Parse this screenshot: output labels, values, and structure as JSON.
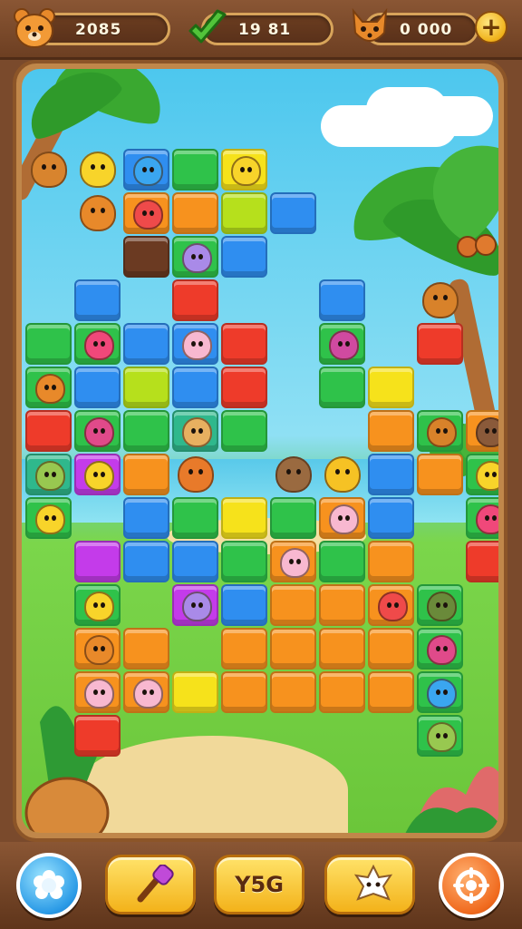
{
  "hud": {
    "left_counter": {
      "icon": "bear-face-icon",
      "value": "2085"
    },
    "middle_counter": {
      "icon": "green-checkmark-icon",
      "value": "19 81"
    },
    "right_counter": {
      "icon": "fox-face-icon",
      "value": "0 000",
      "add_icon": "plus-icon",
      "add_label": "+"
    }
  },
  "colors": {
    "blue": "#2f8ef0",
    "green": "#2fc24a",
    "lime": "#b6e01c",
    "yellow": "#f6e21b",
    "orange": "#f7921e",
    "red": "#ee3b2a",
    "purple": "#c43bea",
    "brown": "#6b3a22",
    "teal": "#2fb88c"
  },
  "board": {
    "tiles": [
      {
        "row": 0,
        "col": 2,
        "color": "blue",
        "animal": "blue-bird"
      },
      {
        "row": 0,
        "col": 3,
        "color": "green",
        "animal": ""
      },
      {
        "row": 0,
        "col": 4,
        "color": "yellow",
        "animal": "yellow-chick"
      },
      {
        "row": 1,
        "col": 2,
        "color": "orange",
        "animal": "red-bird"
      },
      {
        "row": 1,
        "col": 3,
        "color": "orange",
        "animal": ""
      },
      {
        "row": 1,
        "col": 4,
        "color": "lime",
        "animal": ""
      },
      {
        "row": 1,
        "col": 5,
        "color": "blue",
        "animal": ""
      },
      {
        "row": 2,
        "col": 2,
        "color": "brown",
        "animal": ""
      },
      {
        "row": 2,
        "col": 3,
        "color": "green",
        "animal": "purple-hippo"
      },
      {
        "row": 2,
        "col": 4,
        "color": "blue",
        "animal": ""
      },
      {
        "row": 3,
        "col": 1,
        "color": "blue",
        "animal": ""
      },
      {
        "row": 3,
        "col": 3,
        "color": "red",
        "animal": ""
      },
      {
        "row": 3,
        "col": 6,
        "color": "blue",
        "animal": ""
      },
      {
        "row": 4,
        "col": 0,
        "color": "green",
        "animal": ""
      },
      {
        "row": 4,
        "col": 1,
        "color": "green",
        "animal": "pink-bird"
      },
      {
        "row": 4,
        "col": 2,
        "color": "blue",
        "animal": ""
      },
      {
        "row": 4,
        "col": 3,
        "color": "blue",
        "animal": "pink-pig"
      },
      {
        "row": 4,
        "col": 4,
        "color": "red",
        "animal": ""
      },
      {
        "row": 4,
        "col": 6,
        "color": "green",
        "animal": "purple-bird"
      },
      {
        "row": 4,
        "col": 8,
        "color": "red",
        "animal": ""
      },
      {
        "row": 5,
        "col": 0,
        "color": "green",
        "animal": "orange-bear"
      },
      {
        "row": 5,
        "col": 1,
        "color": "blue",
        "animal": ""
      },
      {
        "row": 5,
        "col": 2,
        "color": "lime",
        "animal": ""
      },
      {
        "row": 5,
        "col": 3,
        "color": "blue",
        "animal": ""
      },
      {
        "row": 5,
        "col": 4,
        "color": "red",
        "animal": ""
      },
      {
        "row": 5,
        "col": 6,
        "color": "green",
        "animal": ""
      },
      {
        "row": 5,
        "col": 7,
        "color": "yellow",
        "animal": ""
      },
      {
        "row": 6,
        "col": 0,
        "color": "red",
        "animal": ""
      },
      {
        "row": 6,
        "col": 1,
        "color": "green",
        "animal": "magenta-bird"
      },
      {
        "row": 6,
        "col": 2,
        "color": "green",
        "animal": ""
      },
      {
        "row": 6,
        "col": 3,
        "color": "teal",
        "animal": "hamster"
      },
      {
        "row": 6,
        "col": 4,
        "color": "green",
        "animal": ""
      },
      {
        "row": 6,
        "col": 7,
        "color": "orange",
        "animal": ""
      },
      {
        "row": 6,
        "col": 8,
        "color": "green",
        "animal": "squirrel"
      },
      {
        "row": 6,
        "col": 9,
        "color": "orange",
        "animal": "brown-dog"
      },
      {
        "row": 7,
        "col": 0,
        "color": "teal",
        "animal": "green-frog"
      },
      {
        "row": 7,
        "col": 1,
        "color": "purple",
        "animal": "yellow-chick"
      },
      {
        "row": 7,
        "col": 2,
        "color": "orange",
        "animal": ""
      },
      {
        "row": 7,
        "col": 7,
        "color": "blue",
        "animal": ""
      },
      {
        "row": 7,
        "col": 8,
        "color": "orange",
        "animal": ""
      },
      {
        "row": 7,
        "col": 9,
        "color": "green",
        "animal": "yellow-chick"
      },
      {
        "row": 8,
        "col": 0,
        "color": "green",
        "animal": "yellow-chick"
      },
      {
        "row": 8,
        "col": 2,
        "color": "blue",
        "animal": ""
      },
      {
        "row": 8,
        "col": 3,
        "color": "green",
        "animal": ""
      },
      {
        "row": 8,
        "col": 4,
        "color": "yellow",
        "animal": ""
      },
      {
        "row": 8,
        "col": 5,
        "color": "green",
        "animal": ""
      },
      {
        "row": 8,
        "col": 6,
        "color": "orange",
        "animal": "pink-pig"
      },
      {
        "row": 8,
        "col": 7,
        "color": "blue",
        "animal": ""
      },
      {
        "row": 8,
        "col": 9,
        "color": "green",
        "animal": "pink-bird"
      },
      {
        "row": 9,
        "col": 1,
        "color": "purple",
        "animal": ""
      },
      {
        "row": 9,
        "col": 2,
        "color": "blue",
        "animal": ""
      },
      {
        "row": 9,
        "col": 3,
        "color": "blue",
        "animal": ""
      },
      {
        "row": 9,
        "col": 4,
        "color": "green",
        "animal": ""
      },
      {
        "row": 9,
        "col": 5,
        "color": "orange",
        "animal": "pink-pig"
      },
      {
        "row": 9,
        "col": 6,
        "color": "green",
        "animal": ""
      },
      {
        "row": 9,
        "col": 7,
        "color": "orange",
        "animal": ""
      },
      {
        "row": 9,
        "col": 9,
        "color": "red",
        "animal": ""
      },
      {
        "row": 10,
        "col": 1,
        "color": "green",
        "animal": "yellow-chick"
      },
      {
        "row": 10,
        "col": 3,
        "color": "purple",
        "animal": "purple-hippo"
      },
      {
        "row": 10,
        "col": 4,
        "color": "blue",
        "animal": ""
      },
      {
        "row": 10,
        "col": 5,
        "color": "orange",
        "animal": ""
      },
      {
        "row": 10,
        "col": 6,
        "color": "orange",
        "animal": ""
      },
      {
        "row": 10,
        "col": 7,
        "color": "orange",
        "animal": "red-bird"
      },
      {
        "row": 10,
        "col": 8,
        "color": "green",
        "animal": "green-turtle"
      },
      {
        "row": 11,
        "col": 1,
        "color": "orange",
        "animal": "orange-bear"
      },
      {
        "row": 11,
        "col": 2,
        "color": "orange",
        "animal": ""
      },
      {
        "row": 11,
        "col": 4,
        "color": "orange",
        "animal": ""
      },
      {
        "row": 11,
        "col": 5,
        "color": "orange",
        "animal": ""
      },
      {
        "row": 11,
        "col": 6,
        "color": "orange",
        "animal": ""
      },
      {
        "row": 11,
        "col": 7,
        "color": "orange",
        "animal": ""
      },
      {
        "row": 11,
        "col": 8,
        "color": "green",
        "animal": "magenta-bird"
      },
      {
        "row": 12,
        "col": 1,
        "color": "orange",
        "animal": "pink-pig"
      },
      {
        "row": 12,
        "col": 2,
        "color": "orange",
        "animal": "pink-pig"
      },
      {
        "row": 12,
        "col": 3,
        "color": "yellow",
        "animal": ""
      },
      {
        "row": 12,
        "col": 4,
        "color": "orange",
        "animal": ""
      },
      {
        "row": 12,
        "col": 5,
        "color": "orange",
        "animal": ""
      },
      {
        "row": 12,
        "col": 6,
        "color": "orange",
        "animal": ""
      },
      {
        "row": 12,
        "col": 7,
        "color": "orange",
        "animal": ""
      },
      {
        "row": 12,
        "col": 8,
        "color": "green",
        "animal": "blue-bird"
      },
      {
        "row": 13,
        "col": 1,
        "color": "red",
        "animal": ""
      },
      {
        "row": 13,
        "col": 8,
        "color": "green",
        "animal": "green-frog"
      }
    ],
    "free_animals": [
      {
        "row": 0,
        "col": 0,
        "animal": "fox"
      },
      {
        "row": 0,
        "col": 1,
        "animal": "yellow-chick"
      },
      {
        "row": 1,
        "col": 1,
        "animal": "orange-bear"
      },
      {
        "row": 3,
        "col": 8,
        "animal": "squirrel"
      },
      {
        "row": 7,
        "col": 3,
        "animal": "orange-bird"
      },
      {
        "row": 7,
        "col": 5,
        "animal": "brown-mole"
      },
      {
        "row": 7,
        "col": 6,
        "animal": "yellow-duck"
      }
    ]
  },
  "animal_colors": {
    "blue-bird": "#3aa6f0",
    "yellow-chick": "#f8d42a",
    "red-bird": "#ef4a4a",
    "purple-hippo": "#a98ae8",
    "pink-bird": "#f0487a",
    "pink-pig": "#f8b8d0",
    "purple-bird": "#d04aa0",
    "orange-bear": "#e8892a",
    "magenta-bird": "#e04a8a",
    "hamster": "#e8b060",
    "squirrel": "#d8822a",
    "brown-dog": "#8a5a3a",
    "green-frog": "#98c850",
    "green-turtle": "#6a8a3a",
    "fox": "#d8842e",
    "orange-bird": "#e87a2a",
    "brown-mole": "#9a6a40",
    "yellow-duck": "#f6c224"
  },
  "bottom_bar": {
    "settings_icon": "flower-gear-icon",
    "booster_1_icon": "hammer-icon",
    "booster_2_label": "Y5G",
    "booster_3_icon": "star-creature-icon",
    "spin_icon": "spin-wheel-icon"
  }
}
